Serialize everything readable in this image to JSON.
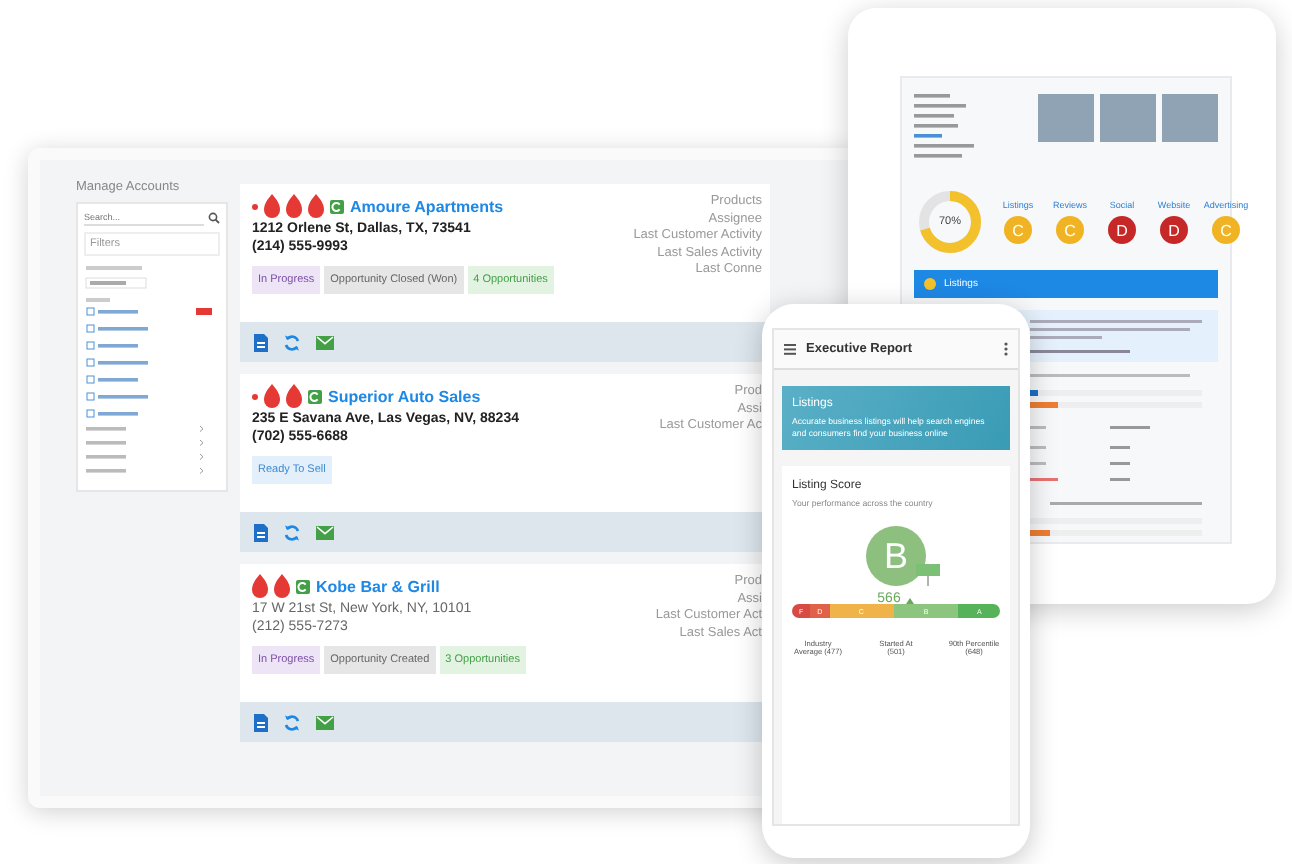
{
  "desktop": {
    "title": "Manage Accounts",
    "search": {
      "placeholder": "Search..."
    },
    "filters_label": "Filters",
    "accounts": [
      {
        "flames": [
          {
            "kind": "flame"
          },
          {
            "kind": "flame"
          },
          {
            "kind": "flame"
          }
        ],
        "new": true,
        "name": "Amoure Apartments",
        "address": "1212 Orlene St, Dallas, TX, 73541",
        "phone": "(214) 555-9993",
        "bold": true,
        "tags": [
          {
            "kind": "status",
            "label": "In Progress"
          },
          {
            "kind": "stage",
            "label": "Opportunity Closed (Won)"
          },
          {
            "kind": "count",
            "label": "4 Opportunities"
          }
        ],
        "fields": [
          "Products",
          "Assignee",
          "Last Customer Activity",
          "Last Sales Activity",
          "Last Conne"
        ]
      },
      {
        "flames": [
          {
            "kind": "flame"
          },
          {
            "kind": "flame"
          }
        ],
        "new": true,
        "name": "Superior Auto Sales",
        "address": "235 E Savana Ave, Las Vegas, NV, 88234",
        "phone": "(702) 555-6688",
        "bold": true,
        "tags": [
          {
            "kind": "ready",
            "label": "Ready To Sell"
          }
        ],
        "fields": [
          "Prod",
          "Assi",
          "Last Customer Ac"
        ]
      },
      {
        "flames": [
          {
            "kind": "flame"
          },
          {
            "kind": "flame"
          }
        ],
        "new": false,
        "name": "Kobe Bar & Grill",
        "address": "17 W 21st St, New York, NY, 10101",
        "phone": "(212) 555-7273",
        "bold": false,
        "tags": [
          {
            "kind": "status",
            "label": "In Progress"
          },
          {
            "kind": "stage",
            "label": "Opportunity Created"
          },
          {
            "kind": "count",
            "label": "3 Opportunities"
          }
        ],
        "fields": [
          "Prod",
          "Assi",
          "Last Customer Act",
          "Last Sales Act"
        ]
      }
    ]
  },
  "tablet": {
    "score": {
      "level": 0.7,
      "reading": "70%"
    },
    "grades": [
      {
        "label": "Listings",
        "grade": "C",
        "color": "#f0b323"
      },
      {
        "label": "Reviews",
        "grade": "C",
        "color": "#f0b323"
      },
      {
        "label": "Social",
        "grade": "D",
        "color": "#c62828"
      },
      {
        "label": "Website",
        "grade": "D",
        "color": "#c62828"
      },
      {
        "label": "Advertising",
        "grade": "C",
        "color": "#f0b323"
      }
    ],
    "section": "Listings"
  },
  "phone": {
    "title": "Executive Report",
    "banner": {
      "title": "Listings",
      "text": "Accurate business listings will help search engines and consumers find your business online"
    },
    "card": {
      "title": "Listing Score",
      "subtitle": "Your performance across the country",
      "grade": "B",
      "score": "566",
      "scale": [
        {
          "label": "F",
          "color": "#d84b45"
        },
        {
          "label": "D",
          "color": "#e0614a"
        },
        {
          "label": "C",
          "color": "#f0b34a"
        },
        {
          "label": "B",
          "color": "#8cc57e"
        },
        {
          "label": "A",
          "color": "#56b35a"
        }
      ],
      "notes": [
        "Industry Average (477)",
        "Started At (501)",
        "90th Percentile (648)"
      ]
    }
  }
}
